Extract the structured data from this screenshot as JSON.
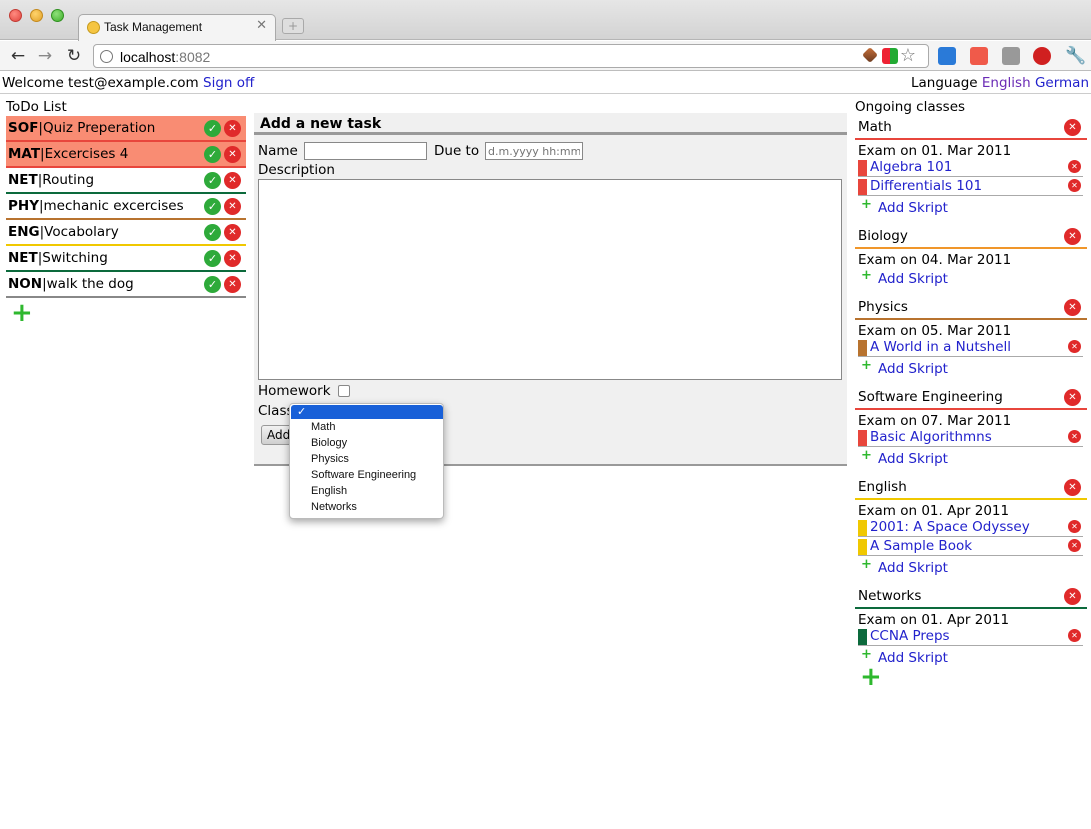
{
  "browser": {
    "tab_title": "Task Management",
    "url_host": "localhost",
    "url_port": ":8082"
  },
  "header": {
    "welcome": "Welcome test@example.com",
    "sign_off": "Sign off",
    "language_label": "Language",
    "languages": [
      "English",
      "German"
    ]
  },
  "todo": {
    "title": "ToDo List",
    "items": [
      {
        "code": "SOF",
        "text": "Quiz Preperation",
        "highlight": true,
        "color": "#e8463c"
      },
      {
        "code": "MAT",
        "text": "Excercises 4",
        "highlight": true,
        "color": "#e8463c"
      },
      {
        "code": "NET",
        "text": "Routing",
        "highlight": false,
        "color": "#0c6a3c"
      },
      {
        "code": "PHY",
        "text": "mechanic excercises",
        "highlight": false,
        "color": "#b8732f"
      },
      {
        "code": "ENG",
        "text": "Vocabolary",
        "highlight": false,
        "color": "#f0c800"
      },
      {
        "code": "NET",
        "text": "Switching",
        "highlight": false,
        "color": "#0c6a3c"
      },
      {
        "code": "NON",
        "text": "walk the dog",
        "highlight": false,
        "color": "#888888"
      }
    ]
  },
  "form": {
    "title": "Add a new task",
    "name_label": "Name",
    "due_label": "Due to",
    "due_placeholder": "d.m.yyyy hh:mm",
    "description_label": "Description",
    "homework_label": "Homework",
    "class_label": "Class",
    "add_button": "Add",
    "class_selected": "✓",
    "class_options": [
      "Math",
      "Biology",
      "Physics",
      "Software Engineering",
      "English",
      "Networks"
    ]
  },
  "classes": {
    "title": "Ongoing classes",
    "add_skript_label": "Add Skript",
    "items": [
      {
        "name": "Math",
        "color": "#e8463c",
        "exam": "Exam on 01. Mar 2011",
        "skripts": [
          "Algebra 101",
          "Differentials 101"
        ]
      },
      {
        "name": "Biology",
        "color": "#f0962a",
        "exam": "Exam on 04. Mar 2011",
        "skripts": []
      },
      {
        "name": "Physics",
        "color": "#b8732f",
        "exam": "Exam on 05. Mar 2011",
        "skripts": [
          "A World in a Nutshell"
        ]
      },
      {
        "name": "Software Engineering",
        "color": "#e8463c",
        "exam": "Exam on 07. Mar 2011",
        "skripts": [
          "Basic Algorithmns"
        ]
      },
      {
        "name": "English",
        "color": "#f0c800",
        "exam": "Exam on 01. Apr 2011",
        "skripts": [
          "2001: A Space Odyssey",
          "A Sample Book"
        ]
      },
      {
        "name": "Networks",
        "color": "#0c6a3c",
        "exam": "Exam on 01. Apr 2011",
        "skripts": [
          "CCNA Preps"
        ]
      }
    ]
  },
  "icons": {
    "done": "checkmark-icon",
    "delete": "close-circle-icon",
    "add": "plus-icon"
  }
}
